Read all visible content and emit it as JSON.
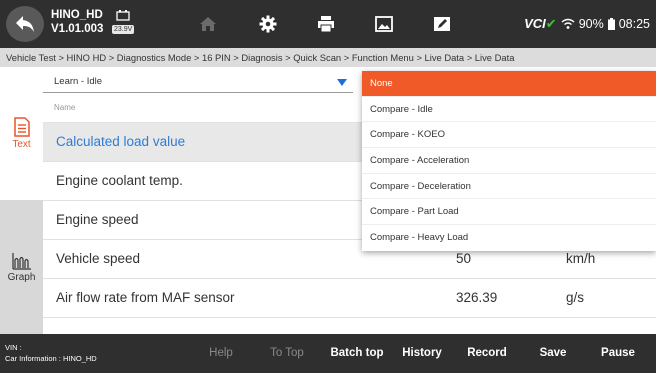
{
  "header": {
    "app_name": "HINO_HD",
    "version": "V1.01.003",
    "voltage": "23.9V",
    "vci_label": "VCI",
    "battery": "90%",
    "time": "08:25",
    "icons": [
      "back-icon",
      "home-icon",
      "gear-icon",
      "print-icon",
      "screenshot-icon",
      "edit-icon",
      "wifi-icon",
      "battery-icon"
    ]
  },
  "breadcrumb": "Vehicle Test > HINO HD > Diagnostics Mode > 16 PIN > Diagnosis > Quick Scan > Function Menu > Live Data > Live Data",
  "side_panel": {
    "text_label": "Text",
    "graph_label": "Graph"
  },
  "dropdown": {
    "value": "Learn - Idle",
    "options": [
      "None",
      "Compare - Idle",
      "Compare - KOEO",
      "Compare - Acceleration",
      "Compare - Deceleration",
      "Compare - Part Load",
      "Compare - Heavy Load"
    ],
    "selected": "None"
  },
  "table": {
    "name_header": "Name",
    "rows": [
      {
        "name": "Calculated load value",
        "value": "",
        "unit": ""
      },
      {
        "name": "Engine coolant temp.",
        "value": "",
        "unit": ""
      },
      {
        "name": "Engine speed",
        "value": "",
        "unit": ""
      },
      {
        "name": "Vehicle speed",
        "value": "50",
        "unit": "km/h"
      },
      {
        "name": "Air flow rate from MAF sensor",
        "value": "326.39",
        "unit": "g/s"
      }
    ]
  },
  "footer": {
    "vin_label": "VIN :",
    "car_info": "Car Information : HINO_HD",
    "buttons": [
      "Help",
      "To Top",
      "Batch top",
      "History",
      "Record",
      "Save",
      "Pause"
    ]
  },
  "colors": {
    "accent": "#f05a28",
    "selected_text": "#2f7bd6",
    "dark_bar": "#2f2f2f"
  }
}
